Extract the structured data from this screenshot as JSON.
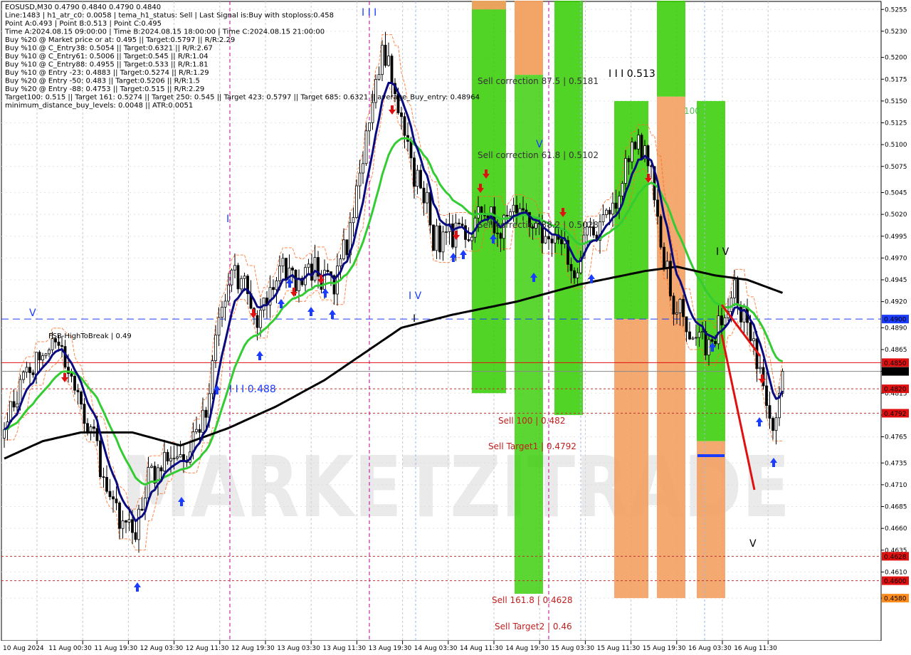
{
  "info_lines": [
    "EOSUSD,M30  0.4790 0.4840 0.4790 0.4840",
    "Line:1483 | h1_atr_c0: 0.0058 | tema_h1_status: Sell | Last Signal is:Buy with stoploss:0.458",
    "Point A:0.493 | Point B:0.513 | Point C:0.495",
    "Time A:2024.08.15 09:00:00 | Time B:2024.08.15 18:00:00 | Time C:2024.08.15 21:00:00",
    "Buy %20 @ Market price or at: 0.495 || Target:0.5797 || R/R:2.29",
    "Buy %10 @ C_Entry38: 0.5054 || Target:0.6321 || R/R:2.67",
    "Buy %10 @ C_Entry61: 0.5006 || Target:0.545 || R/R:1.04",
    "Buy %10 @ C_Entry88: 0.4955 || Target:0.533 || R/R:1.81",
    "Buy %10 @ Entry -23: 0.4883 || Target:0.5274 || R/R:1.29",
    "Buy %20 @ Entry -50: 0.483 || Target:0.5206 || R/R:1.5",
    "Buy %20 @ Entry -88: 0.4753 || Target:0.515 || R/R:2.29",
    "Target100: 0.515 || Target 161: 0.5274 || Target 250: 0.545 || Target 423: 0.5797 || Target 685: 0.6321 || average_Buy_entry: 0.48964",
    "minimum_distance_buy_levels: 0.0048 || ATR:0.0051"
  ],
  "levels": {
    "fsb_label": "FSB-HighToBreak | 0.49",
    "sell_correction_875": "Sell correction 87.5 | 0.5181",
    "sell_correction_618": "Sell correction 61.8 | 0.5102",
    "sell_correction_382": "Sell correction 38.2 | 0.5028",
    "sell_100": "Sell 100 | 0.482",
    "sell_target1": "Sell Target1 | 0.4792",
    "sell_1618": "Sell 161.8 | 0.4628",
    "sell_target2": "Sell Target2 | 0.46",
    "wave_b": "I I I 0.513",
    "wave_c": "I I I 0.488",
    "partial_100": "100"
  },
  "wave_marks": [
    "I I I",
    "I",
    "I V",
    "I",
    "V",
    "V",
    "I V",
    "V"
  ],
  "price_badges": [
    {
      "text": "0.4900",
      "bg": "#1a3cff"
    },
    {
      "text": "0.4850",
      "bg": "#e01010"
    },
    {
      "text": "0.4840",
      "bg": "#000000"
    },
    {
      "text": "0.4820",
      "bg": "#e01010"
    },
    {
      "text": "0.4792",
      "bg": "#e01010"
    },
    {
      "text": "0.4628",
      "bg": "#e01010"
    },
    {
      "text": "0.4600",
      "bg": "#e01010"
    },
    {
      "text": "0.4580",
      "bg": "#ff8c1a"
    }
  ],
  "watermark": "MARKETZITRADE",
  "colors": {
    "green_zone": "#33cc00",
    "orange_zone": "#f2a060",
    "ema_blue": "#0a0a80",
    "ema_green": "#33cc33",
    "ma_black": "#000000",
    "bull": "#000000",
    "bear": "#000000",
    "buy_arrow": "#1a3cff",
    "sell_arrow": "#e01010"
  },
  "chart_data": {
    "type": "candlestick",
    "symbol": "EOSUSD",
    "timeframe": "M30",
    "ylim": [
      0.458,
      0.5265
    ],
    "y_ticks": [
      "0.5255",
      "0.5230",
      "0.5200",
      "0.5175",
      "0.5150",
      "0.5125",
      "0.5100",
      "0.5075",
      "0.5045",
      "0.5020",
      "0.4995",
      "0.4970",
      "0.4945",
      "0.4920",
      "0.4890",
      "0.4865",
      "0.4840",
      "0.4815",
      "0.4790",
      "0.4765",
      "0.4735",
      "0.4710",
      "0.4685",
      "0.4660",
      "0.4635",
      "0.4610",
      "0.4580"
    ],
    "x_ticks": [
      "10 Aug 2024",
      "11 Aug 00:30",
      "11 Aug 19:30",
      "12 Aug 03:30",
      "12 Aug 11:30",
      "12 Aug 19:30",
      "13 Aug 03:30",
      "13 Aug 11:30",
      "13 Aug 19:30",
      "14 Aug 03:30",
      "14 Aug 11:30",
      "14 Aug 19:30",
      "15 Aug 03:30",
      "15 Aug 11:30",
      "15 Aug 19:30",
      "16 Aug 03:30",
      "16 Aug 11:30"
    ],
    "close_path": [
      [
        0,
        0.479
      ],
      [
        6,
        0.483
      ],
      [
        11,
        0.486
      ],
      [
        16,
        0.488
      ],
      [
        20,
        0.485
      ],
      [
        24,
        0.479
      ],
      [
        28,
        0.476
      ],
      [
        33,
        0.47
      ],
      [
        37,
        0.466
      ],
      [
        41,
        0.466
      ],
      [
        45,
        0.472
      ],
      [
        50,
        0.474
      ],
      [
        55,
        0.473
      ],
      [
        59,
        0.476
      ],
      [
        63,
        0.48
      ],
      [
        67,
        0.49
      ],
      [
        71,
        0.495
      ],
      [
        75,
        0.494
      ],
      [
        79,
        0.49
      ],
      [
        83,
        0.492
      ],
      [
        87,
        0.496
      ],
      [
        91,
        0.494
      ],
      [
        95,
        0.496
      ],
      [
        99,
        0.495
      ],
      [
        103,
        0.493
      ],
      [
        107,
        0.499
      ],
      [
        111,
        0.506
      ],
      [
        115,
        0.514
      ],
      [
        118,
        0.52
      ],
      [
        121,
        0.518
      ],
      [
        124,
        0.512
      ],
      [
        128,
        0.506
      ],
      [
        131,
        0.505
      ],
      [
        134,
        0.499
      ],
      [
        138,
        0.499
      ],
      [
        142,
        0.5
      ],
      [
        146,
        0.5
      ],
      [
        150,
        0.503
      ],
      [
        154,
        0.5
      ],
      [
        158,
        0.501
      ],
      [
        162,
        0.503
      ],
      [
        166,
        0.501
      ],
      [
        170,
        0.499
      ],
      [
        174,
        0.499
      ],
      [
        178,
        0.495
      ],
      [
        182,
        0.5
      ],
      [
        186,
        0.5
      ],
      [
        190,
        0.502
      ],
      [
        194,
        0.507
      ],
      [
        198,
        0.511
      ],
      [
        201,
        0.508
      ],
      [
        204,
        0.502
      ],
      [
        208,
        0.493
      ],
      [
        212,
        0.49
      ],
      [
        216,
        0.488
      ],
      [
        220,
        0.486
      ],
      [
        224,
        0.491
      ],
      [
        228,
        0.493
      ],
      [
        232,
        0.489
      ],
      [
        236,
        0.484
      ],
      [
        240,
        0.478
      ],
      [
        243,
        0.484
      ]
    ],
    "ma200_path": [
      [
        0,
        0.474
      ],
      [
        12,
        0.476
      ],
      [
        24,
        0.477
      ],
      [
        40,
        0.477
      ],
      [
        55,
        0.4755
      ],
      [
        70,
        0.4775
      ],
      [
        85,
        0.48
      ],
      [
        100,
        0.483
      ],
      [
        112,
        0.486
      ],
      [
        124,
        0.489
      ],
      [
        140,
        0.4905
      ],
      [
        160,
        0.492
      ],
      [
        180,
        0.494
      ],
      [
        200,
        0.4955
      ],
      [
        210,
        0.496
      ],
      [
        222,
        0.495
      ],
      [
        232,
        0.4945
      ],
      [
        243,
        0.493
      ]
    ],
    "annotations": [
      "FSB-HighToBreak | 0.49",
      "Sell correction 87.5 | 0.5181",
      "Sell correction 61.8 | 0.5102",
      "Sell correction 38.2 | 0.5028",
      "Sell 100 | 0.482",
      "Sell Target1 | 0.4792",
      "Sell 161.8 | 0.4628",
      "Sell Target2 | 0.46",
      "I I I 0.513",
      "I I I 0.488"
    ],
    "horizontal_levels": [
      {
        "value": 0.49,
        "style": "dashed",
        "color": "#1a3cff"
      },
      {
        "value": 0.485,
        "style": "solid",
        "color": "#e01010"
      },
      {
        "value": 0.484,
        "style": "solid",
        "color": "#888888"
      },
      {
        "value": 0.482,
        "style": "dotted",
        "color": "#c03030"
      },
      {
        "value": 0.4792,
        "style": "dotted",
        "color": "#c03030"
      },
      {
        "value": 0.4628,
        "style": "dotted",
        "color": "#c03030"
      },
      {
        "value": 0.46,
        "style": "dotted",
        "color": "#c03030"
      }
    ],
    "grid": true
  }
}
